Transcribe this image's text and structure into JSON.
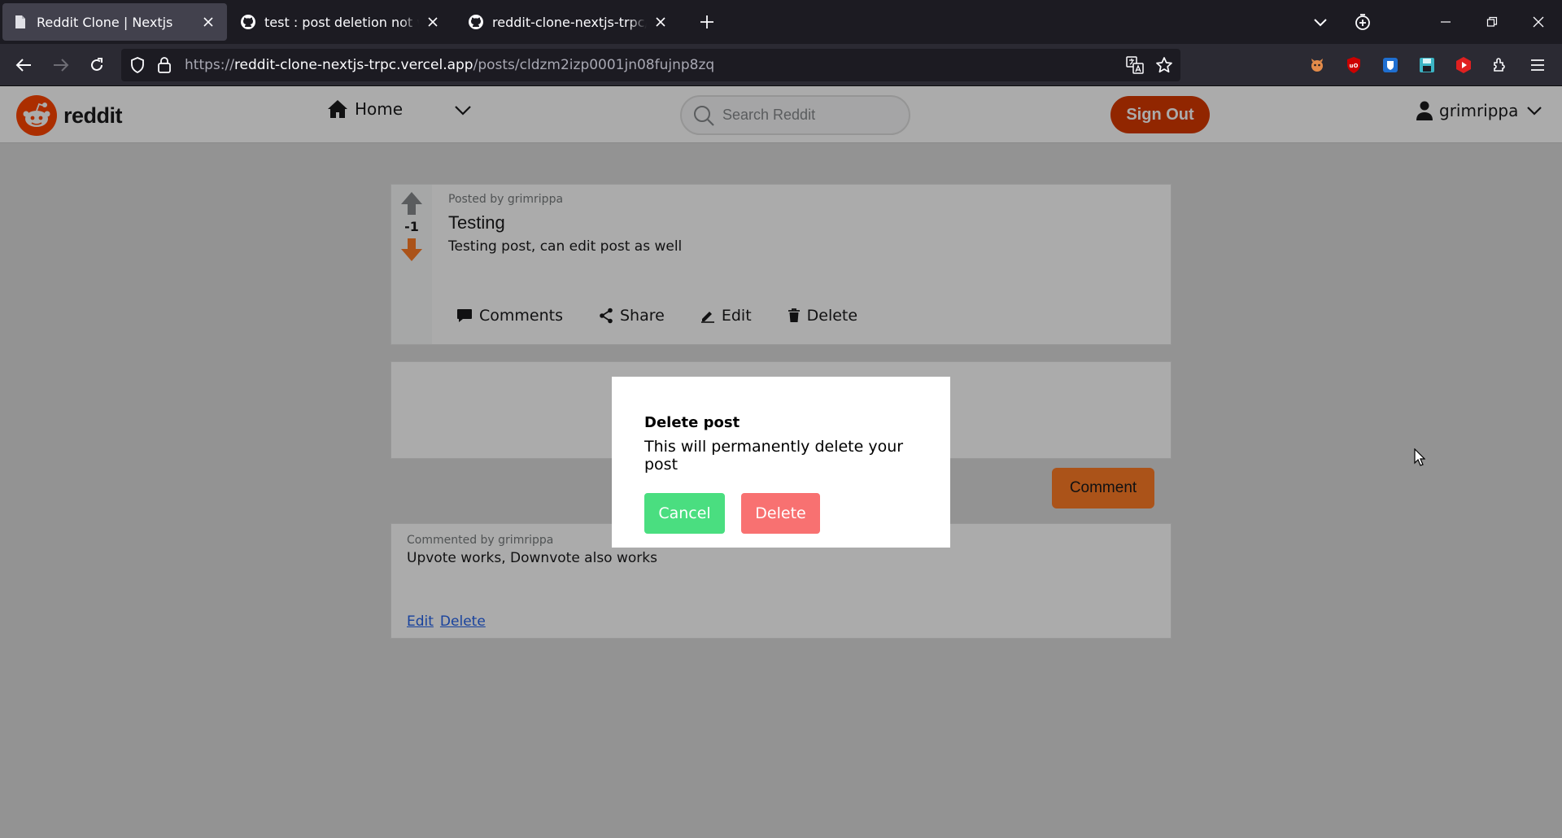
{
  "browser": {
    "tabs": [
      {
        "title": "Reddit Clone | Nextjs",
        "active": true
      },
      {
        "title": "test : post deletion not working",
        "active": false
      },
      {
        "title": "reddit-clone-nextjs-trpc/README.md",
        "active": false
      }
    ],
    "url": {
      "scheme": "https://",
      "host": "reddit-clone-nextjs-trpc.vercel.app",
      "path": "/posts/cldzm2izp0001jn08fujnp8zq"
    }
  },
  "header": {
    "logo_text": "reddit",
    "home_label": "Home",
    "search_placeholder": "Search Reddit",
    "signout_label": "Sign Out",
    "username": "grimrippa"
  },
  "post": {
    "score": "-1",
    "meta": "Posted by grimrippa",
    "title": "Testing",
    "body": "Testing post, can edit post as well",
    "actions": {
      "comments": "Comments",
      "share": "Share",
      "edit": "Edit",
      "delete": "Delete"
    }
  },
  "comment_form": {
    "button_label": "Comment"
  },
  "comments": [
    {
      "meta": "Commented by grimrippa",
      "text": "Upvote works, Downvote also works",
      "edit_label": "Edit",
      "delete_label": "Delete"
    }
  ],
  "modal": {
    "title": "Delete post",
    "text": "This will permanently delete your post",
    "cancel_label": "Cancel",
    "delete_label": "Delete"
  },
  "colors": {
    "reddit_orange": "#ff4500",
    "signout_bg": "#d93a00",
    "comment_btn": "#ff7c26",
    "cancel_btn": "#4ade80",
    "delete_btn": "#f87171",
    "upvote": "#878a8c",
    "downvote": "#ff7c26"
  }
}
